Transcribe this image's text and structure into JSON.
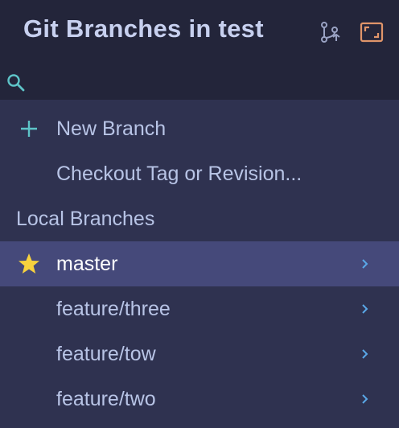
{
  "header": {
    "title": "Git Branches in test",
    "icons": [
      "git-branches-icon",
      "expand-icon"
    ]
  },
  "search": {
    "value": "",
    "placeholder": ""
  },
  "actions": [
    {
      "label": "New Branch",
      "icon": "plus-icon"
    },
    {
      "label": "Checkout Tag or Revision...",
      "icon": ""
    }
  ],
  "local_branches": {
    "heading": "Local Branches",
    "items": [
      {
        "name": "master",
        "favorite": true,
        "selected": true
      },
      {
        "name": "feature/three",
        "favorite": false,
        "selected": false
      },
      {
        "name": "feature/tow",
        "favorite": false,
        "selected": false
      },
      {
        "name": "feature/two",
        "favorite": false,
        "selected": false
      }
    ]
  },
  "colors": {
    "header_bg": "#23253a",
    "list_bg": "#2f3250",
    "selected_bg": "#45497a",
    "title": "#c7d0ef",
    "text": "#b8c4e6",
    "accent_teal": "#5ec4c8",
    "chevron": "#5aa8e8",
    "star": "#f7d23e",
    "expand_icon": "#e0956a"
  }
}
